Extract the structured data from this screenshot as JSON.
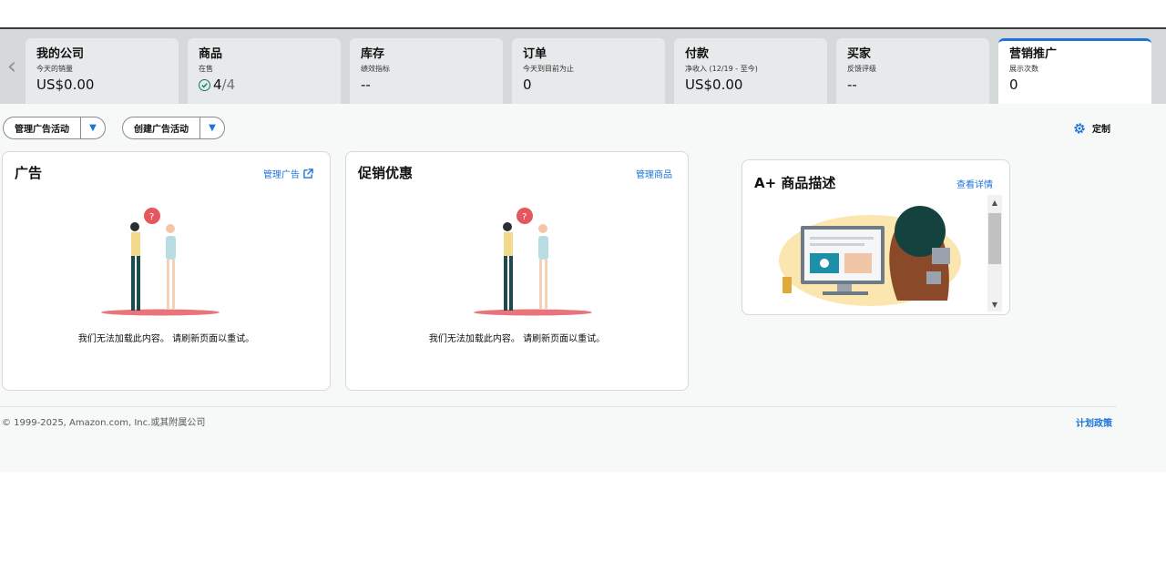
{
  "tabs": [
    {
      "title": "我的公司",
      "subtitle": "今天的销量",
      "value": "US$0.00"
    },
    {
      "title": "商品",
      "subtitle": "在售",
      "value_main": "4",
      "value_sep": "/4"
    },
    {
      "title": "库存",
      "subtitle": "绩效指标",
      "value": "--"
    },
    {
      "title": "订单",
      "subtitle": "今天到目前为止",
      "value": "0"
    },
    {
      "title": "付款",
      "subtitle": "净收入 (12/19 - 至今)",
      "value": "US$0.00"
    },
    {
      "title": "买家",
      "subtitle": "反馈评级",
      "value": "--"
    },
    {
      "title": "营销推广",
      "subtitle": "展示次数",
      "value": "0"
    }
  ],
  "toolbar": {
    "manage_campaigns": "管理广告活动",
    "create_campaign": "创建广告活动",
    "customize": "定制"
  },
  "cards": {
    "ads": {
      "title": "广告",
      "link": "管理广告",
      "message": "我们无法加载此内容。 请刷新页面以重试。"
    },
    "promotions": {
      "title": "促销优惠",
      "link": "管理商品",
      "message": "我们无法加载此内容。 请刷新页面以重试。"
    },
    "aplus": {
      "title": "A+ 商品描述",
      "link": "查看详情"
    }
  },
  "footer": {
    "copyright": "© 1999-2025, Amazon.com, Inc.或其附属公司",
    "policy": "计划政策"
  },
  "colors": {
    "accent": "#1c74d9",
    "success": "#067d62",
    "tab_bg": "#e7e9ea"
  }
}
